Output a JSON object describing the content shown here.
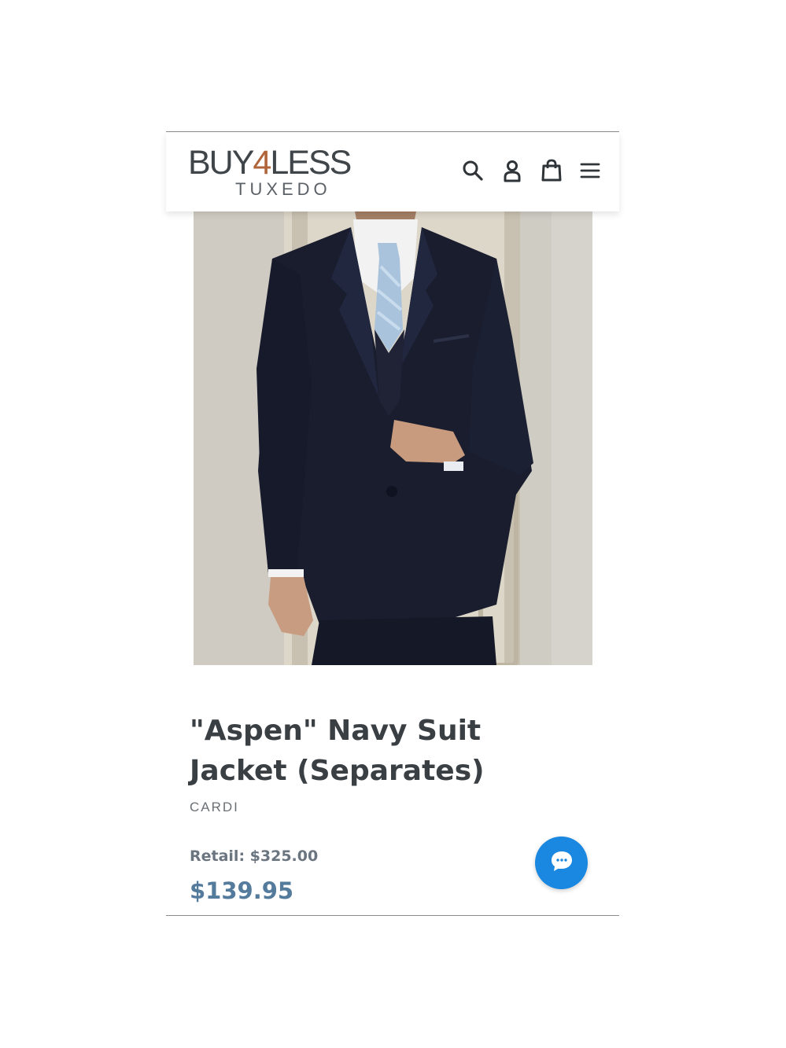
{
  "header": {
    "logo_main_left": "BUY",
    "logo_main_accent": "4",
    "logo_main_right": "LESS",
    "logo_sub": "TUXEDO",
    "icons": [
      "search-icon",
      "account-icon",
      "cart-icon",
      "menu-icon"
    ]
  },
  "product": {
    "image_alt": "Navy three-piece suit with light blue tie",
    "title": "\"Aspen\" Navy Suit Jacket (Separates)",
    "vendor": "CARDI",
    "retail_label": "Retail: $325.00",
    "price": "$139.95"
  },
  "chat": {
    "icon": "chat-icon"
  },
  "colors": {
    "accent": "#1a88e0",
    "price": "#557b9c",
    "logo_accent": "#b0643a",
    "text": "#3a3f44"
  }
}
